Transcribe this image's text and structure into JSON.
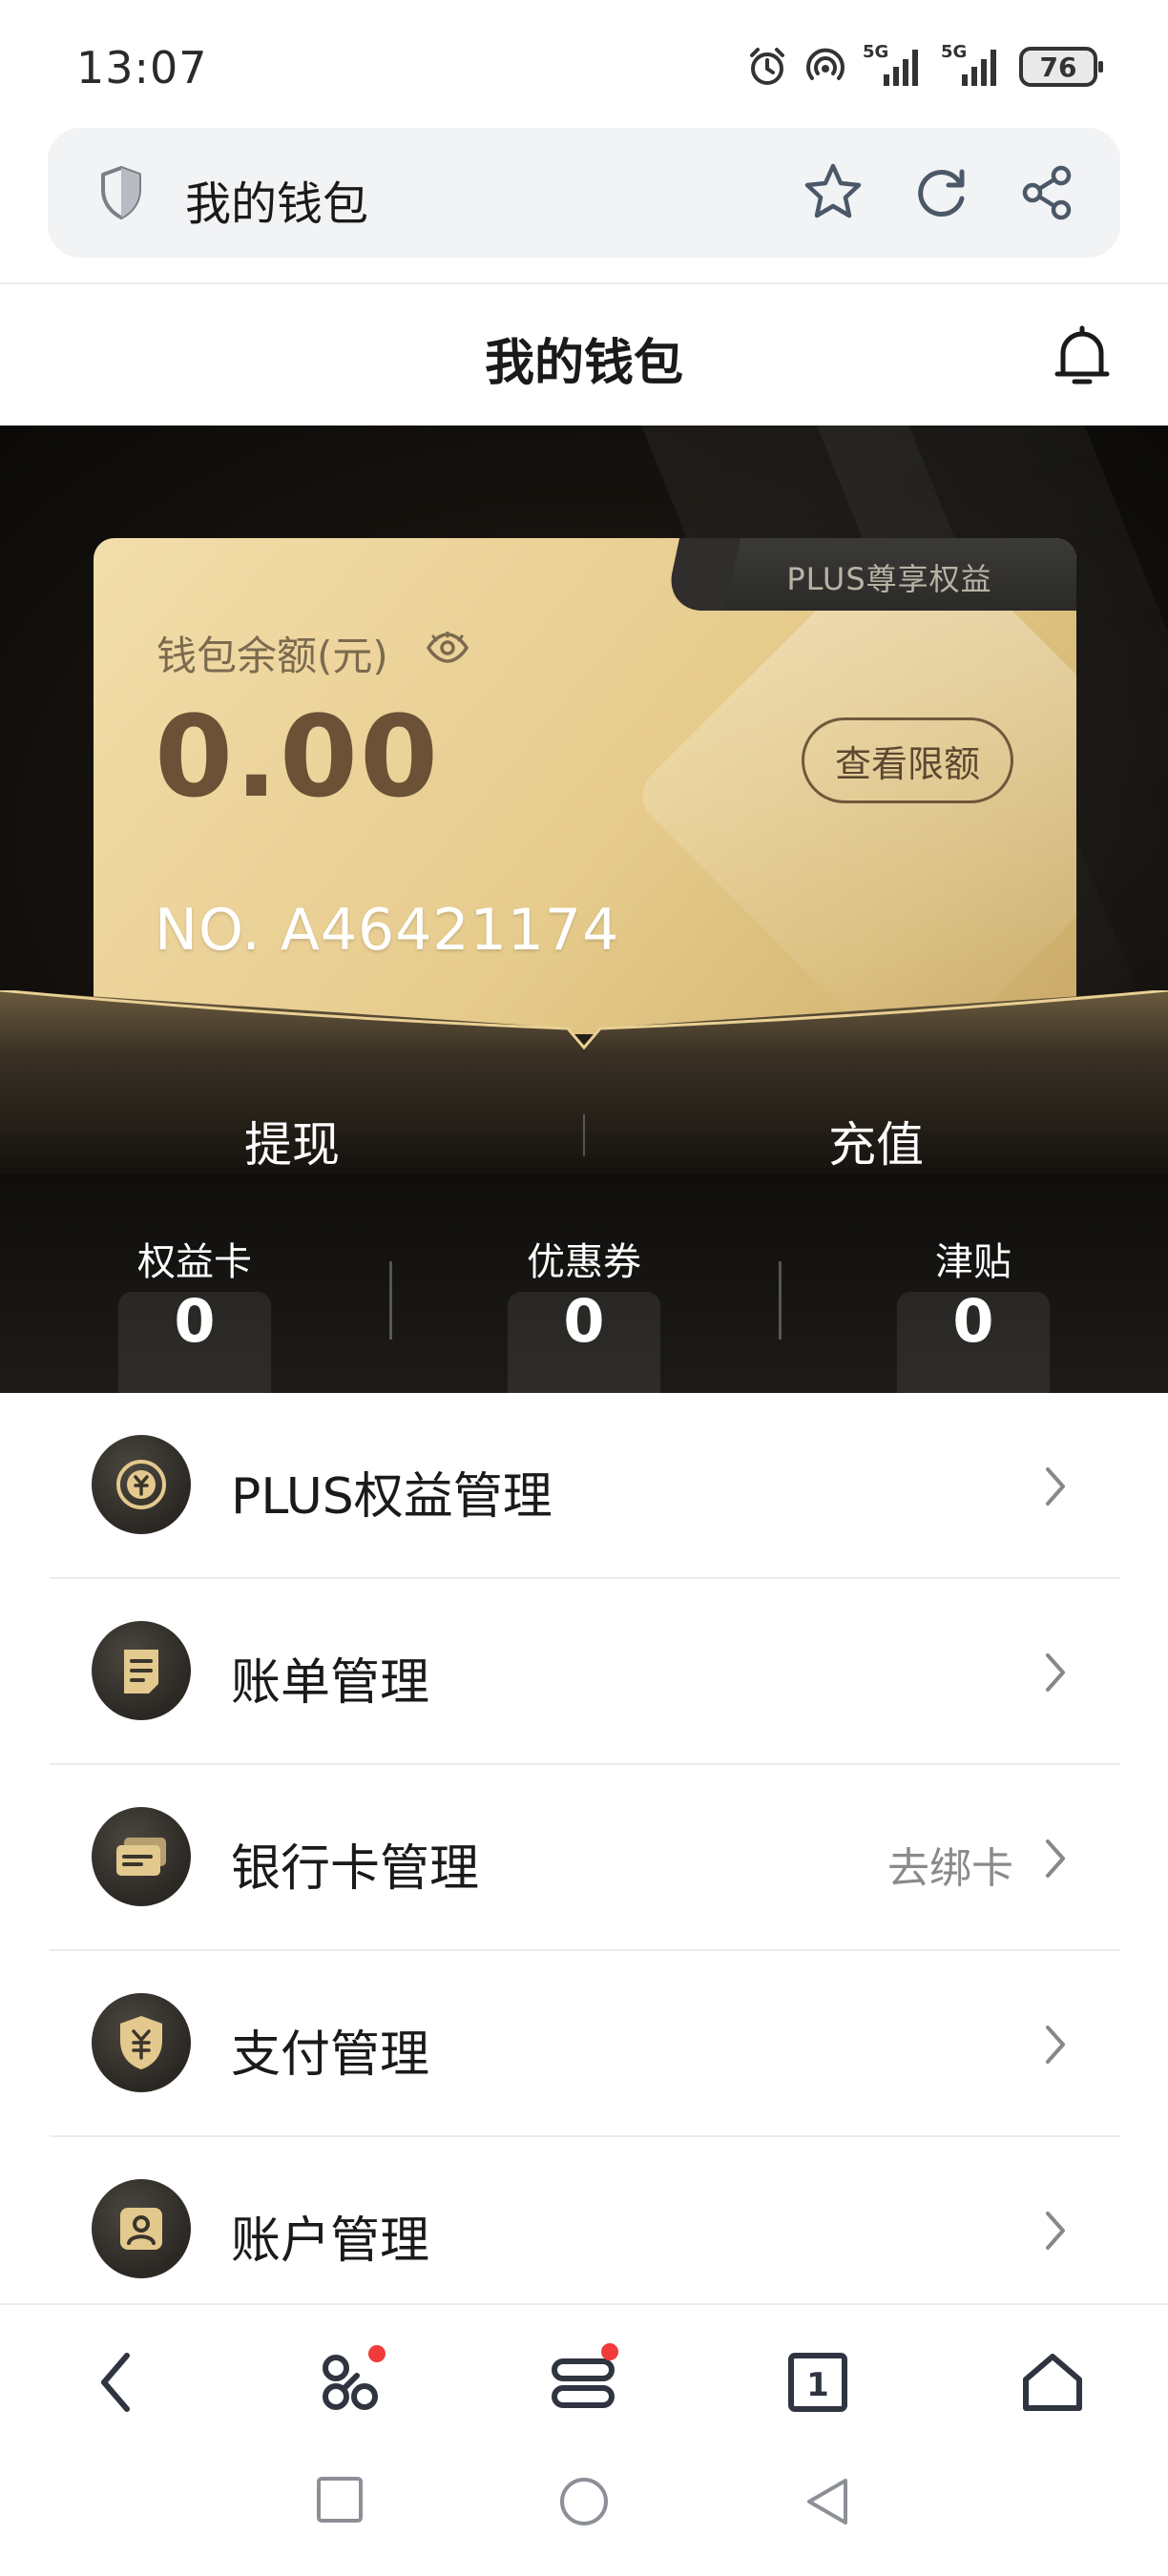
{
  "status_bar": {
    "time": "13:07",
    "network_1": "5G",
    "network_2": "5G",
    "battery": "76",
    "icons": [
      "alarm-icon",
      "hotspot-icon",
      "signal-icon",
      "signal-icon",
      "battery-icon"
    ]
  },
  "address_bar": {
    "title": "我的钱包",
    "icons": [
      "shield-icon",
      "star-icon",
      "reload-icon",
      "share-icon"
    ]
  },
  "header": {
    "title": "我的钱包",
    "icon": "bell-icon"
  },
  "card": {
    "plus_tab": "PLUS尊享权益",
    "balance_label": "钱包余额(元)",
    "balance_value": "0.00",
    "limit_button": "查看限额",
    "card_number": "NO. A46421174",
    "colors": {
      "gold_light": "#f2deaa",
      "gold_dark": "#c9a967",
      "text_brown": "#6b5236"
    }
  },
  "actions": {
    "withdraw": "提现",
    "recharge": "充值"
  },
  "stats": [
    {
      "label": "权益卡",
      "value": "0"
    },
    {
      "label": "优惠券",
      "value": "0"
    },
    {
      "label": "津贴",
      "value": "0"
    }
  ],
  "menu": [
    {
      "label": "PLUS权益管理",
      "extra": "",
      "icon": "plus-benefits-icon"
    },
    {
      "label": "账单管理",
      "extra": "",
      "icon": "bill-icon"
    },
    {
      "label": "银行卡管理",
      "extra": "去绑卡",
      "icon": "bank-card-icon"
    },
    {
      "label": "支付管理",
      "extra": "",
      "icon": "payment-icon"
    },
    {
      "label": "账户管理",
      "extra": "",
      "icon": "account-icon"
    }
  ],
  "bottom_nav": {
    "tab_count": "1",
    "icons": [
      "back-icon",
      "apps-icon",
      "menu-icon",
      "tabs-icon",
      "home-icon"
    ],
    "badge_color": "#ef3b3b"
  },
  "system_nav": {
    "icons": [
      "recents-icon",
      "home-circle-icon",
      "back-triangle-icon"
    ]
  }
}
